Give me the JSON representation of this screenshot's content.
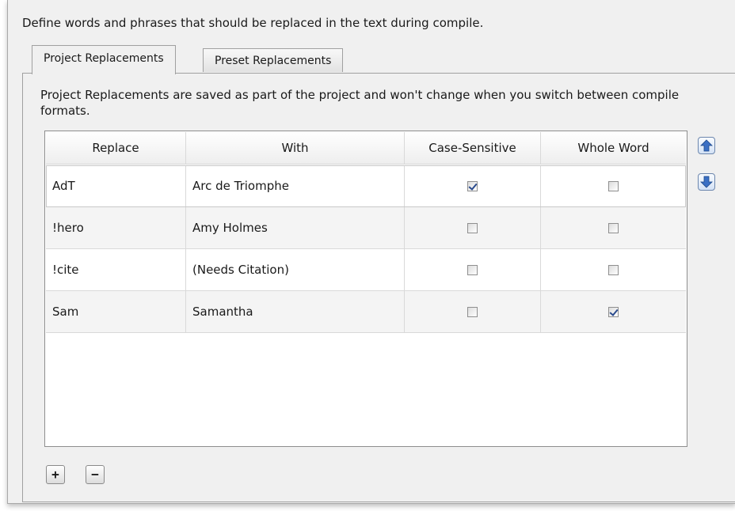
{
  "intro_text": "Define words and phrases that should be replaced in the text during compile.",
  "tabs": [
    {
      "label": "Project Replacements",
      "active": true
    },
    {
      "label": "Preset Replacements",
      "active": false
    }
  ],
  "description": "Project Replacements are saved as part of the project and won't change when you switch between compile formats.",
  "table": {
    "columns": [
      "Replace",
      "With",
      "Case-Sensitive",
      "Whole Word"
    ],
    "rows": [
      {
        "replace": "AdT",
        "with": "Arc de Triomphe",
        "case_sensitive": true,
        "whole_word": false
      },
      {
        "replace": "!hero",
        "with": "Amy Holmes",
        "case_sensitive": false,
        "whole_word": false
      },
      {
        "replace": "!cite",
        "with": "(Needs Citation)",
        "case_sensitive": false,
        "whole_word": false
      },
      {
        "replace": "Sam",
        "with": "Samantha",
        "case_sensitive": false,
        "whole_word": true
      }
    ]
  },
  "buttons": {
    "add": "+",
    "remove": "−"
  },
  "icons": {
    "move_up": "arrow-up-icon",
    "move_down": "arrow-down-icon"
  },
  "colors": {
    "arrow_blue": "#3a6fc4",
    "check": "#2a4b8d"
  }
}
